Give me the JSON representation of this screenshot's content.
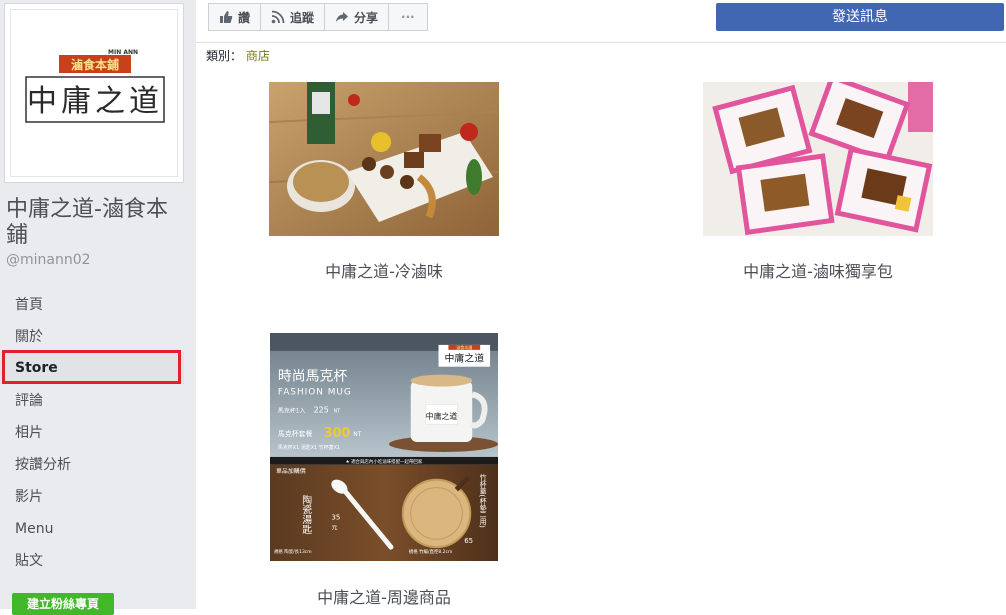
{
  "sidebar": {
    "logo": {
      "top_text": "MIN ANN",
      "banner_text": "滷食本鋪",
      "main_text": "中庸之道"
    },
    "page_name": "中庸之道-滷食本鋪",
    "handle": "@minann02",
    "nav": [
      {
        "label": "首頁"
      },
      {
        "label": "關於"
      },
      {
        "label": "Store"
      },
      {
        "label": "評論"
      },
      {
        "label": "相片"
      },
      {
        "label": "按讚分析"
      },
      {
        "label": "影片"
      },
      {
        "label": "Menu"
      },
      {
        "label": "貼文"
      }
    ],
    "create_page_label": "建立粉絲專頁"
  },
  "actions": {
    "like": "讚",
    "follow": "追蹤",
    "share": "分享",
    "more": "···",
    "send_message": "發送訊息"
  },
  "category": {
    "label": "類別：",
    "value": "商店"
  },
  "products": [
    {
      "title": "中庸之道-冷滷味"
    },
    {
      "title": "中庸之道-滷味獨享包"
    },
    {
      "title": "中庸之道-周邊商品",
      "image_text": {
        "brand_banner": "滷食本鋪",
        "brand_name": "中庸之道",
        "headline": "時尚馬克杯",
        "headline_en": "FASHION MUG",
        "single_label": "馬克杯1入",
        "single_price": "225",
        "currency": "NT",
        "set_label": "馬克杯套餐",
        "set_price": "300",
        "set_items": "馬克杯X1  湯匙X1  竹杯蓋X1",
        "notice": "★ 適合與店內小吃滷味搭配一起帶回家",
        "addon_title": "單品加購價",
        "spoon_name": "陶瓷湯匙",
        "spoon_price": "35",
        "spoon_unit": "元",
        "spoon_spec": "規格 陶瓷/長13cm",
        "lid_name": "竹杯蓋(杯墊二用)",
        "lid_price": "65",
        "lid_spec": "規格 竹編/直徑8.2cm"
      }
    }
  ],
  "colors": {
    "sidebar_bg": "#e9ebee",
    "primary_blue": "#4267b2",
    "highlight_red": "#e0202e",
    "category_link": "#7a7a0f",
    "green_button": "#42b72a"
  }
}
